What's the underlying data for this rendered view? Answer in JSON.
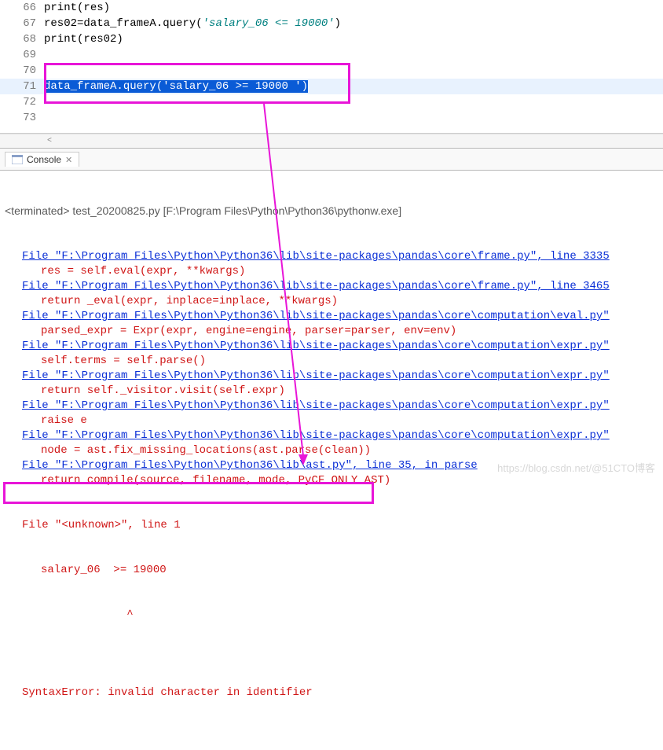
{
  "editor": {
    "lines": [
      {
        "num": "66",
        "tokens": [
          {
            "cls": "call",
            "t": "print"
          },
          {
            "cls": "text",
            "t": "(res)"
          }
        ]
      },
      {
        "num": "67",
        "tokens": [
          {
            "cls": "text",
            "t": "res02=data_frameA.query("
          },
          {
            "cls": "str",
            "t": "'salary_06 <= 19000'"
          },
          {
            "cls": "text",
            "t": ")"
          }
        ]
      },
      {
        "num": "68",
        "tokens": [
          {
            "cls": "call",
            "t": "print"
          },
          {
            "cls": "text",
            "t": "(res02)"
          }
        ]
      },
      {
        "num": "69",
        "tokens": []
      },
      {
        "num": "70",
        "tokens": []
      },
      {
        "num": "71",
        "highlight": true,
        "tokens": [
          {
            "cls": "sel",
            "t": "data_frameA.query("
          },
          {
            "cls": "sel str",
            "t": "'salary_06 >= 19000 '"
          },
          {
            "cls": "sel",
            "t": ")"
          }
        ]
      },
      {
        "num": "72",
        "tokens": []
      },
      {
        "num": "73",
        "tokens": []
      }
    ]
  },
  "console": {
    "tab_label": "Console",
    "terminated": "<terminated> test_20200825.py [F:\\Program Files\\Python\\Python36\\pythonw.exe]",
    "trace": [
      {
        "link": "File \"F:\\Program Files\\Python\\Python36\\lib\\site-packages\\pandas\\core\\frame.py\", line 3335",
        "code": "res = self.eval(expr, **kwargs)"
      },
      {
        "link": "File \"F:\\Program Files\\Python\\Python36\\lib\\site-packages\\pandas\\core\\frame.py\", line 3465",
        "code": "return _eval(expr, inplace=inplace, **kwargs)"
      },
      {
        "link": "File \"F:\\Program Files\\Python\\Python36\\lib\\site-packages\\pandas\\core\\computation\\eval.py\"",
        "code": "parsed_expr = Expr(expr, engine=engine, parser=parser, env=env)"
      },
      {
        "link": "File \"F:\\Program Files\\Python\\Python36\\lib\\site-packages\\pandas\\core\\computation\\expr.py\"",
        "code": "self.terms = self.parse()"
      },
      {
        "link": "File \"F:\\Program Files\\Python\\Python36\\lib\\site-packages\\pandas\\core\\computation\\expr.py\"",
        "code": "return self._visitor.visit(self.expr)"
      },
      {
        "link": "File \"F:\\Program Files\\Python\\Python36\\lib\\site-packages\\pandas\\core\\computation\\expr.py\"",
        "code": "raise e"
      },
      {
        "link": "File \"F:\\Program Files\\Python\\Python36\\lib\\site-packages\\pandas\\core\\computation\\expr.py\"",
        "code": "node = ast.fix_missing_locations(ast.parse(clean))"
      },
      {
        "link": "File \"F:\\Program Files\\Python\\Python36\\lib\\ast.py\", line 35, in parse",
        "code": "return compile(source, filename, mode, PyCF_ONLY_AST)"
      }
    ],
    "tail": {
      "file_line": "File \"<unknown>\", line 1",
      "snippet": "salary_06  >= 19000",
      "caret": "             ^",
      "error": "SyntaxError: invalid character in identifier"
    }
  },
  "watermark": "https://blog.csdn.net/@51CTO博客"
}
